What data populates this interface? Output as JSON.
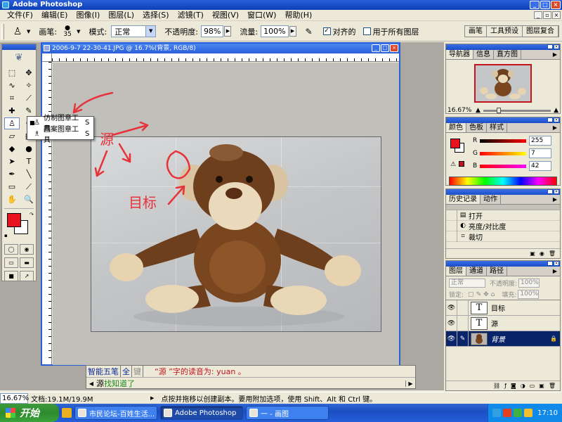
{
  "app": {
    "title": "Adobe Photoshop"
  },
  "menu": [
    "文件(F)",
    "编辑(E)",
    "图像(I)",
    "图层(L)",
    "选择(S)",
    "滤镜(T)",
    "视图(V)",
    "窗口(W)",
    "帮助(H)"
  ],
  "options": {
    "brush_label": "画笔:",
    "brush_size": "35",
    "mode_label": "模式:",
    "mode_value": "正常",
    "opacity_label": "不透明度:",
    "opacity_value": "98%",
    "flow_label": "流量:",
    "flow_value": "100%",
    "aligned_label": "对齐的",
    "aligned_checked": "✓",
    "all_layers_label": "用于所有图层",
    "palette_well_tabs": [
      "画笔",
      "工具预设",
      "图层复合"
    ]
  },
  "document": {
    "title": "2006-9-7 22-30-41.JPG @ 16.7%(背景, RGB/8)"
  },
  "flyout": {
    "items": [
      {
        "label": "仿制图章工具",
        "key": "S"
      },
      {
        "label": "图案图章工具",
        "key": "S"
      }
    ]
  },
  "annotations": {
    "source": "源",
    "target": "目标"
  },
  "ime": {
    "name": "智能五笔",
    "mode": "全",
    "sep": "键",
    "hint": "“源 ”字的读音为: yuan 。",
    "cand1": "源",
    "cand2": "找知道了"
  },
  "status": {
    "zoom": "16.67%",
    "doc_size": "文档:19.1M/19.9M",
    "hint": "点按并拖移以创建副本。要用附加选项，使用 Shift、Alt 和 Ctrl 键。"
  },
  "navigator": {
    "tabs": [
      "导航器",
      "信息",
      "直方图"
    ],
    "zoom": "16.67%"
  },
  "color_panel": {
    "tabs": [
      "颜色",
      "色板",
      "样式"
    ],
    "r_label": "R",
    "g_label": "G",
    "b_label": "B",
    "r": "255",
    "g": "7",
    "b": "42"
  },
  "history": {
    "tabs": [
      "历史记录",
      "动作"
    ],
    "items": [
      "打开",
      "亮度/对比度",
      "裁切"
    ]
  },
  "layers": {
    "tabs": [
      "图层",
      "通道",
      "路径"
    ],
    "blend_mode": "正常",
    "opacity_label": "不透明度:",
    "opacity_value": "100%",
    "lock_label": "锁定:",
    "fill_label": "填充:",
    "fill_value": "100%",
    "items": [
      {
        "name": "目标",
        "thumb": "T"
      },
      {
        "name": "源",
        "thumb": "T"
      },
      {
        "name": "背景",
        "thumb": ""
      }
    ]
  },
  "taskbar": {
    "start": "开始",
    "tasks": [
      "市民论坛-百姓生活...",
      "Adobe Photoshop",
      "一 - 画图"
    ],
    "clock": "17:10"
  },
  "colors": {
    "foreground": "#e8131f",
    "background": "#ffffff",
    "titlebar": "#2a5fd8",
    "annotation": "#e8323a"
  }
}
